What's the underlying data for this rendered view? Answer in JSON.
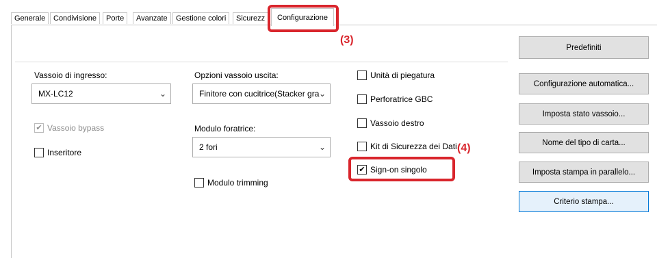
{
  "tabs": [
    "Generale",
    "Condivisione",
    "Porte",
    "Avanzate",
    "Gestione colori",
    "Sicurezz",
    "Configurazione"
  ],
  "active_tab": "Configurazione",
  "callouts": {
    "tab": "(3)",
    "checkbox": "(4)"
  },
  "col1": {
    "input_tray_label": "Vassoio di ingresso:",
    "input_tray_value": "MX-LC12",
    "bypass_label": "Vassoio bypass",
    "bypass_checked": true,
    "inserter_label": "Inseritore",
    "inserter_checked": false
  },
  "col2": {
    "output_options_label": "Opzioni vassoio uscita:",
    "output_options_value": "Finitore con cucitrice(Stacker gran",
    "punch_label": "Modulo foratrice:",
    "punch_value": "2 fori",
    "trimming_label": "Modulo trimming",
    "trimming_checked": false
  },
  "col3": [
    {
      "label": "Unità di piegatura",
      "checked": false
    },
    {
      "label": "Perforatrice GBC",
      "checked": false
    },
    {
      "label": "Vassoio destro",
      "checked": false
    },
    {
      "label": "Kit di Sicurezza dei Dati",
      "checked": false
    },
    {
      "label": "Sign-on singolo",
      "checked": true
    }
  ],
  "buttons": {
    "defaults": "Predefiniti",
    "auto_config": "Configurazione automatica...",
    "tray_status": "Imposta stato vassoio...",
    "paper_type_name": "Nome del tipo di carta...",
    "parallel_print": "Imposta stampa in parallelo...",
    "print_policy": "Criterio stampa..."
  },
  "colors": {
    "callout_red": "#d9252c",
    "focus_blue": "#0078d7"
  }
}
